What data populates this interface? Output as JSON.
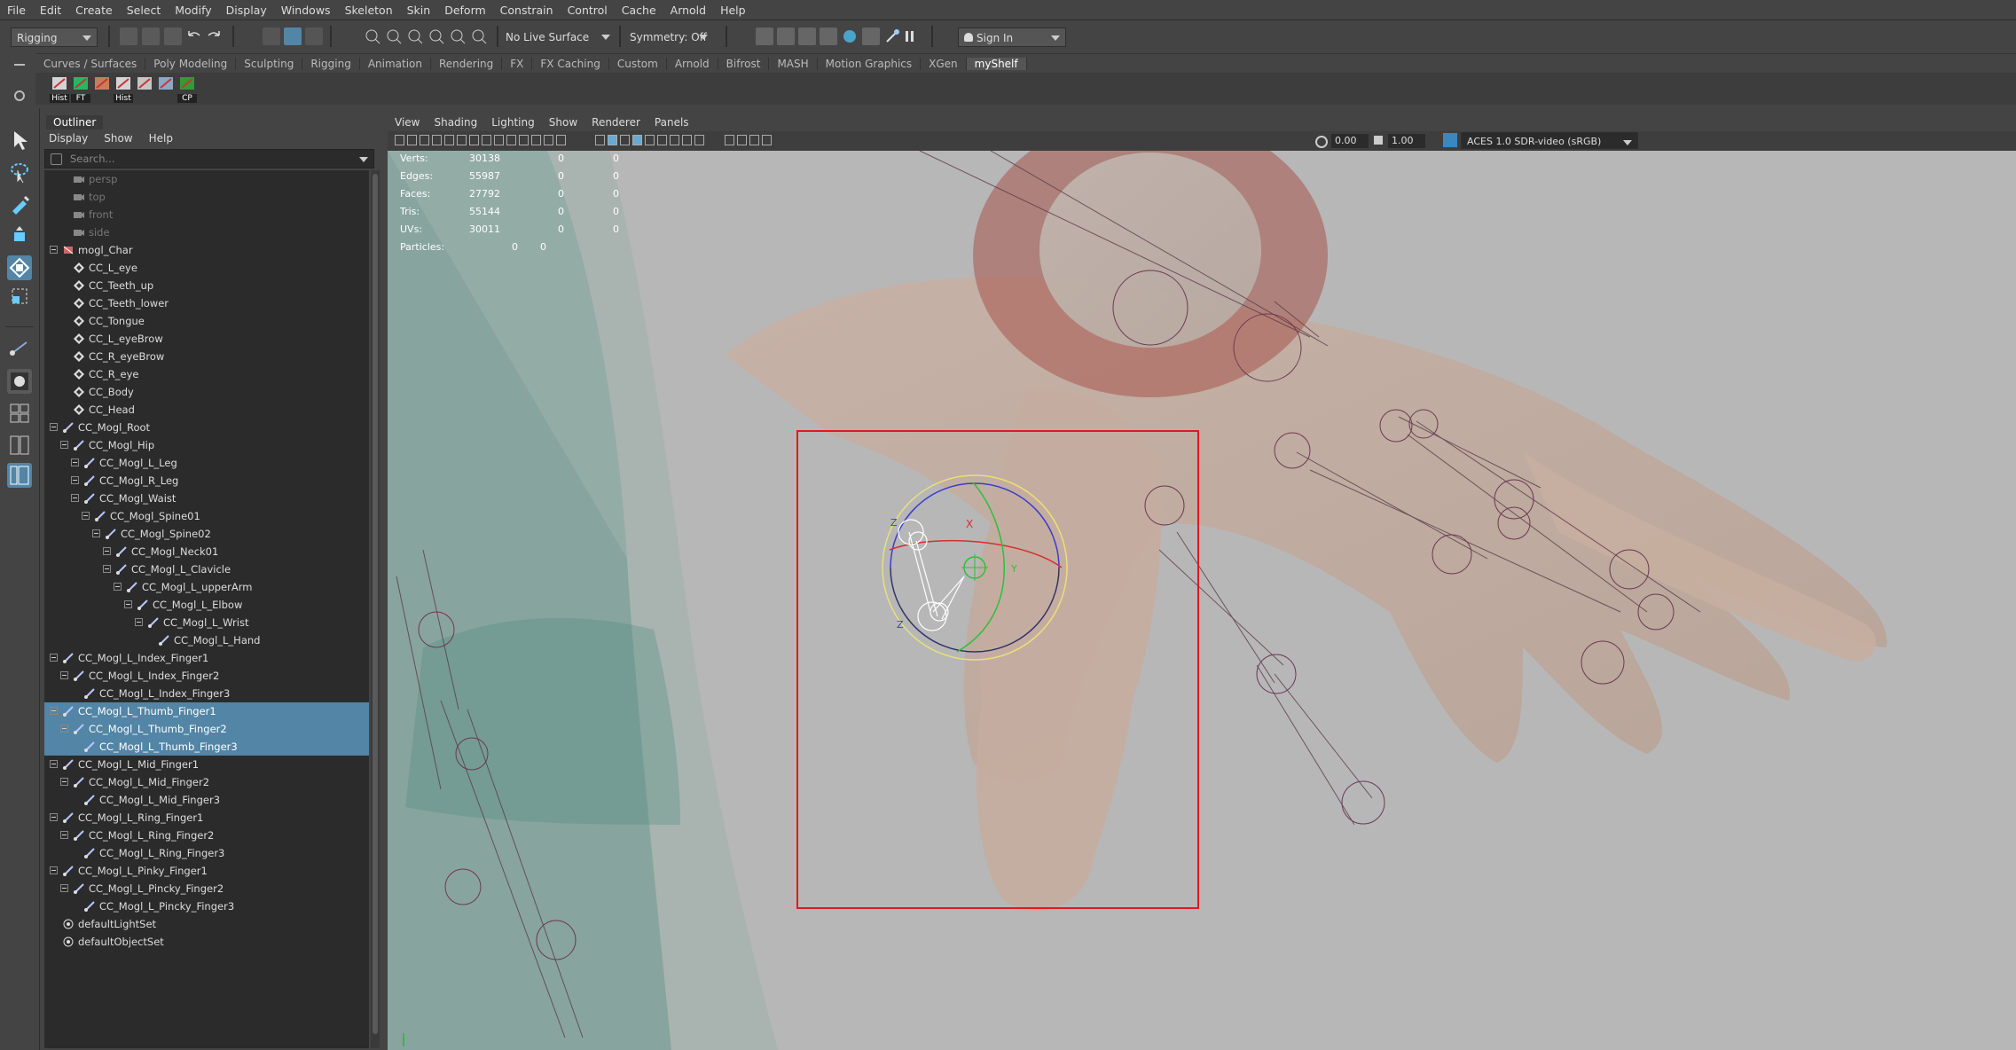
{
  "menubar": [
    "File",
    "Edit",
    "Create",
    "Select",
    "Modify",
    "Display",
    "Windows",
    "Skeleton",
    "Skin",
    "Deform",
    "Constrain",
    "Control",
    "Cache",
    "Arnold",
    "Help"
  ],
  "statusline": {
    "menuset": "Rigging",
    "live_surface": "No Live Surface",
    "symmetry": "Symmetry: Off",
    "sign_in": "Sign In"
  },
  "shelf": {
    "tabs": [
      "Curves / Surfaces",
      "Poly Modeling",
      "Sculpting",
      "Rigging",
      "Animation",
      "Rendering",
      "FX",
      "FX Caching",
      "Custom",
      "Arnold",
      "Bifrost",
      "MASH",
      "Motion Graphics",
      "XGen",
      "myShelf"
    ],
    "active_tab": "myShelf",
    "icons": [
      {
        "name": "history-icon",
        "label": "Hist"
      },
      {
        "name": "freeze-transform-icon",
        "label": "FT"
      },
      {
        "name": "paint-weights-icon",
        "label": ""
      },
      {
        "name": "history-delete-icon",
        "label": "Hist"
      },
      {
        "name": "joint-tool-icon",
        "label": ""
      },
      {
        "name": "ik-handle-icon",
        "label": ""
      },
      {
        "name": "center-pivot-icon",
        "label": "CP"
      }
    ]
  },
  "outliner": {
    "title": "Outliner",
    "menu": [
      "Display",
      "Show",
      "Help"
    ],
    "search_placeholder": "Search...",
    "items": [
      {
        "label": "persp",
        "indent": 1,
        "icon": "camera",
        "dim": true,
        "exp": false
      },
      {
        "label": "top",
        "indent": 1,
        "icon": "camera",
        "dim": true,
        "exp": false
      },
      {
        "label": "front",
        "indent": 1,
        "icon": "camera",
        "dim": true,
        "exp": false
      },
      {
        "label": "side",
        "indent": 1,
        "icon": "camera",
        "dim": true,
        "exp": false
      },
      {
        "label": "mogl_Char",
        "indent": 0,
        "icon": "group",
        "exp": true
      },
      {
        "label": "CC_L_eye",
        "indent": 1,
        "icon": "mesh"
      },
      {
        "label": "CC_Teeth_up",
        "indent": 1,
        "icon": "mesh"
      },
      {
        "label": "CC_Teeth_lower",
        "indent": 1,
        "icon": "mesh"
      },
      {
        "label": "CC_Tongue",
        "indent": 1,
        "icon": "mesh"
      },
      {
        "label": "CC_L_eyeBrow",
        "indent": 1,
        "icon": "mesh"
      },
      {
        "label": "CC_R_eyeBrow",
        "indent": 1,
        "icon": "mesh"
      },
      {
        "label": "CC_R_eye",
        "indent": 1,
        "icon": "mesh"
      },
      {
        "label": "CC_Body",
        "indent": 1,
        "icon": "mesh"
      },
      {
        "label": "CC_Head",
        "indent": 1,
        "icon": "mesh"
      },
      {
        "label": "CC_Mogl_Root",
        "indent": 0,
        "icon": "joint",
        "exp": true
      },
      {
        "label": "CC_Mogl_Hip",
        "indent": 1,
        "icon": "joint",
        "exp": true
      },
      {
        "label": "CC_Mogl_L_Leg",
        "indent": 2,
        "icon": "joint",
        "exp": true
      },
      {
        "label": "CC_Mogl_R_Leg",
        "indent": 2,
        "icon": "joint",
        "exp": true
      },
      {
        "label": "CC_Mogl_Waist",
        "indent": 2,
        "icon": "joint",
        "exp": true
      },
      {
        "label": "CC_Mogl_Spine01",
        "indent": 3,
        "icon": "joint",
        "exp": true
      },
      {
        "label": "CC_Mogl_Spine02",
        "indent": 4,
        "icon": "joint",
        "exp": true
      },
      {
        "label": "CC_Mogl_Neck01",
        "indent": 5,
        "icon": "joint",
        "exp": true
      },
      {
        "label": "CC_Mogl_L_Clavicle",
        "indent": 5,
        "icon": "joint",
        "exp": true
      },
      {
        "label": "CC_Mogl_L_upperArm",
        "indent": 6,
        "icon": "joint",
        "exp": true
      },
      {
        "label": "CC_Mogl_L_Elbow",
        "indent": 7,
        "icon": "joint",
        "exp": true
      },
      {
        "label": "CC_Mogl_L_Wrist",
        "indent": 8,
        "icon": "joint",
        "exp": true
      },
      {
        "label": "CC_Mogl_L_Hand",
        "indent": 9,
        "icon": "joint"
      },
      {
        "label": "CC_Mogl_L_Index_Finger1",
        "indent": 0,
        "icon": "joint",
        "exp": true
      },
      {
        "label": "CC_Mogl_L_Index_Finger2",
        "indent": 1,
        "icon": "joint",
        "exp": true
      },
      {
        "label": "CC_Mogl_L_Index_Finger3",
        "indent": 2,
        "icon": "joint"
      },
      {
        "label": "CC_Mogl_L_Thumb_Finger1",
        "indent": 0,
        "icon": "joint",
        "exp": true,
        "sel": true
      },
      {
        "label": "CC_Mogl_L_Thumb_Finger2",
        "indent": 1,
        "icon": "joint",
        "exp": true,
        "sel": true
      },
      {
        "label": "CC_Mogl_L_Thumb_Finger3",
        "indent": 2,
        "icon": "joint",
        "sel": true
      },
      {
        "label": "CC_Mogl_L_Mid_Finger1",
        "indent": 0,
        "icon": "joint",
        "exp": true
      },
      {
        "label": "CC_Mogl_L_Mid_Finger2",
        "indent": 1,
        "icon": "joint",
        "exp": true
      },
      {
        "label": "CC_Mogl_L_Mid_Finger3",
        "indent": 2,
        "icon": "joint"
      },
      {
        "label": "CC_Mogl_L_Ring_Finger1",
        "indent": 0,
        "icon": "joint",
        "exp": true
      },
      {
        "label": "CC_Mogl_L_Ring_Finger2",
        "indent": 1,
        "icon": "joint",
        "exp": true
      },
      {
        "label": "CC_Mogl_L_Ring_Finger3",
        "indent": 2,
        "icon": "joint"
      },
      {
        "label": "CC_Mogl_L_Pinky_Finger1",
        "indent": 0,
        "icon": "joint",
        "exp": true
      },
      {
        "label": "CC_Mogl_L_Pincky_Finger2",
        "indent": 1,
        "icon": "joint",
        "exp": true
      },
      {
        "label": "CC_Mogl_L_Pincky_Finger3",
        "indent": 2,
        "icon": "joint"
      },
      {
        "label": "defaultLightSet",
        "indent": 0,
        "icon": "set"
      },
      {
        "label": "defaultObjectSet",
        "indent": 0,
        "icon": "set"
      }
    ]
  },
  "viewport": {
    "menu": [
      "View",
      "Shading",
      "Lighting",
      "Show",
      "Renderer",
      "Panels"
    ],
    "camera_near": "0.00",
    "camera_far": "1.00",
    "color_space": "ACES 1.0 SDR-video (sRGB)",
    "hud": [
      {
        "label": "Verts:",
        "v1": "30138",
        "v2": "0",
        "v3": "0"
      },
      {
        "label": "Edges:",
        "v1": "55987",
        "v2": "0",
        "v3": "0"
      },
      {
        "label": "Faces:",
        "v1": "27792",
        "v2": "0",
        "v3": "0"
      },
      {
        "label": "Tris:",
        "v1": "55144",
        "v2": "0",
        "v3": "0"
      },
      {
        "label": "UVs:",
        "v1": "30011",
        "v2": "0",
        "v3": "0"
      }
    ],
    "particles_label": "Particles:",
    "particles_v1": "0",
    "particles_v2": "0",
    "gizmo_labels": {
      "x": "X",
      "y": "Y",
      "z": "Z"
    },
    "selection_box_color": "#e0191e"
  }
}
